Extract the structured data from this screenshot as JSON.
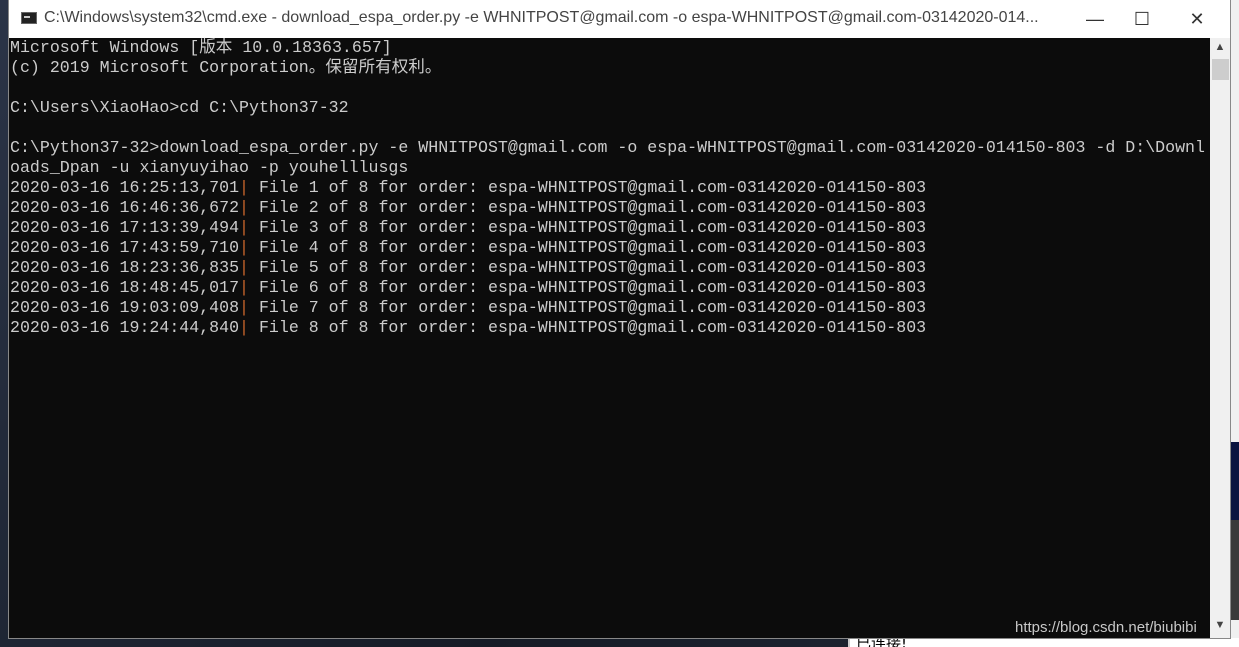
{
  "window": {
    "title": "C:\\Windows\\system32\\cmd.exe - download_espa_order.py  -e WHNITPOST@gmail.com -o espa-WHNITPOST@gmail.com-03142020-014...",
    "minimize": "—",
    "maximize": "☐",
    "close": "✕"
  },
  "console": {
    "lines": [
      "Microsoft Windows [版本 10.0.18363.657]",
      "(c) 2019 Microsoft Corporation。保留所有权利。",
      "",
      "C:\\Users\\XiaoHao>cd C:\\Python37-32",
      "",
      "C:\\Python37-32>download_espa_order.py -e WHNITPOST@gmail.com -o espa-WHNITPOST@gmail.com-03142020-014150-803 -d D:\\Downl",
      "oads_Dpan -u xianyuyihao -p youhelllusgs"
    ],
    "log": [
      {
        "time": "2020-03-16 16:25:13,701",
        "msg": " File 1 of 8 for order: espa-WHNITPOST@gmail.com-03142020-014150-803"
      },
      {
        "time": "2020-03-16 16:46:36,672",
        "msg": " File 2 of 8 for order: espa-WHNITPOST@gmail.com-03142020-014150-803"
      },
      {
        "time": "2020-03-16 17:13:39,494",
        "msg": " File 3 of 8 for order: espa-WHNITPOST@gmail.com-03142020-014150-803"
      },
      {
        "time": "2020-03-16 17:43:59,710",
        "msg": " File 4 of 8 for order: espa-WHNITPOST@gmail.com-03142020-014150-803"
      },
      {
        "time": "2020-03-16 18:23:36,835",
        "msg": " File 5 of 8 for order: espa-WHNITPOST@gmail.com-03142020-014150-803"
      },
      {
        "time": "2020-03-16 18:48:45,017",
        "msg": " File 6 of 8 for order: espa-WHNITPOST@gmail.com-03142020-014150-803"
      },
      {
        "time": "2020-03-16 19:03:09,408",
        "msg": " File 7 of 8 for order: espa-WHNITPOST@gmail.com-03142020-014150-803"
      },
      {
        "time": "2020-03-16 19:24:44,840",
        "msg": " File 8 of 8 for order: espa-WHNITPOST@gmail.com-03142020-014150-803"
      }
    ],
    "separator": "|"
  },
  "watermark": "https://blog.csdn.net/biubibi",
  "background_panel_text": "已连接!",
  "colors": {
    "console_bg": "#0c0c0c",
    "console_fg": "#cccccc",
    "separator": "#c8642a"
  }
}
